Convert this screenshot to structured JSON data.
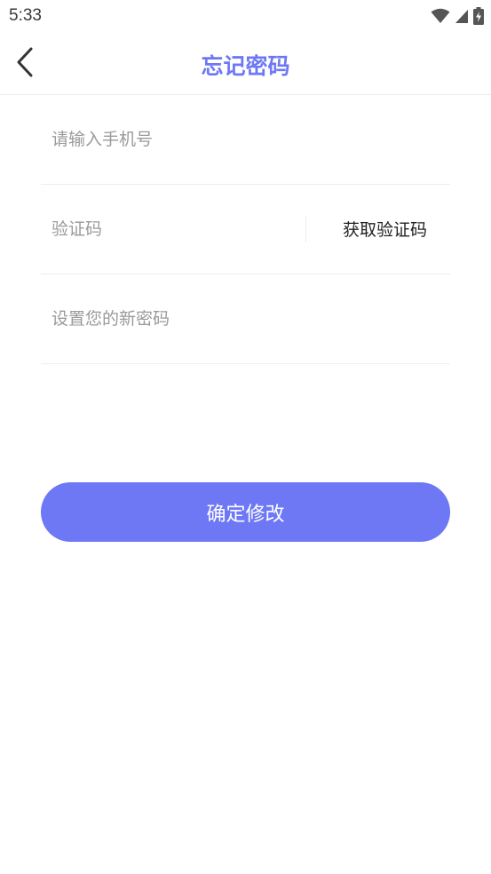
{
  "status_bar": {
    "time": "5:33",
    "icons": [
      "wifi-icon",
      "cell-signal-icon",
      "battery-charging-icon"
    ]
  },
  "header": {
    "title": "忘记密码",
    "back_icon": "chevron-left-icon"
  },
  "form": {
    "phone_placeholder": "请输入手机号",
    "code_placeholder": "验证码",
    "get_code_label": "获取验证码",
    "password_placeholder": "设置您的新密码"
  },
  "actions": {
    "submit_label": "确定修改"
  },
  "colors": {
    "accent": "#6e78f5",
    "placeholder": "#9a9a9a",
    "divider": "#ededed"
  }
}
